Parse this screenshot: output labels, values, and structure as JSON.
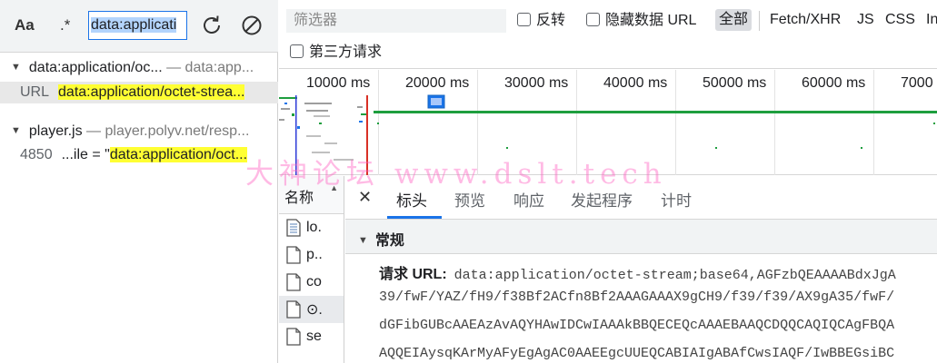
{
  "search": {
    "case_label": "Aa",
    "regex_label": ".*",
    "query": "data:applicati"
  },
  "results": [
    {
      "file": "data:application/oc...",
      "separator": " — ",
      "origin": "data:app...",
      "match_label": "URL",
      "match_text": "data:application/octet-strea..."
    },
    {
      "file": "player.js",
      "separator": " — ",
      "origin": "player.polyv.net/resp...",
      "line_number": "4850",
      "line_prefix": "...ile = \"",
      "match_text": "data:application/oct..."
    }
  ],
  "filter": {
    "placeholder": "筛选器",
    "invert_label": "反转",
    "hide_data_urls_label": "隐藏数据 URL",
    "types": [
      "全部",
      "Fetch/XHR",
      "JS",
      "CSS",
      "In"
    ],
    "third_party_label": "第三方请求"
  },
  "timeline": {
    "ticks": [
      "10000 ms",
      "20000 ms",
      "30000 ms",
      "40000 ms",
      "50000 ms",
      "60000 ms",
      "7000"
    ]
  },
  "request_list": {
    "header": "名称",
    "items": [
      "lo.",
      "p..",
      "co",
      "⊙.",
      "se"
    ]
  },
  "details": {
    "tabs": [
      "标头",
      "预览",
      "响应",
      "发起程序",
      "计时"
    ],
    "section_title": "常规",
    "request_url_label": "请求 URL:",
    "lines": [
      "data:application/octet-stream;base64,AGFzbQEAAAABdxJgA",
      "39/fwF/YAZ/fH9/f38Bf2ACfn8Bf2AAAGAAAX9gCH9/f39/f39/AX9gA35/fwF/",
      "dGFibGUBcAAEAzAvAQYHAwIDCwIAAAkBBQECEQcAAAEBAAQCDQQCAQIQCAgFBQA",
      "AQQEIAysqKArMyAFyEgAgAC0AAEEgcUUEQCABIAIgABAfCwsIAQF/IwBBEGsiBC"
    ]
  },
  "watermark": "大神论坛   www.dslt.tech",
  "colors": {
    "highlight": "#ffff33",
    "accent": "#1a73e8",
    "timeline_green": "#1e9e3e"
  }
}
